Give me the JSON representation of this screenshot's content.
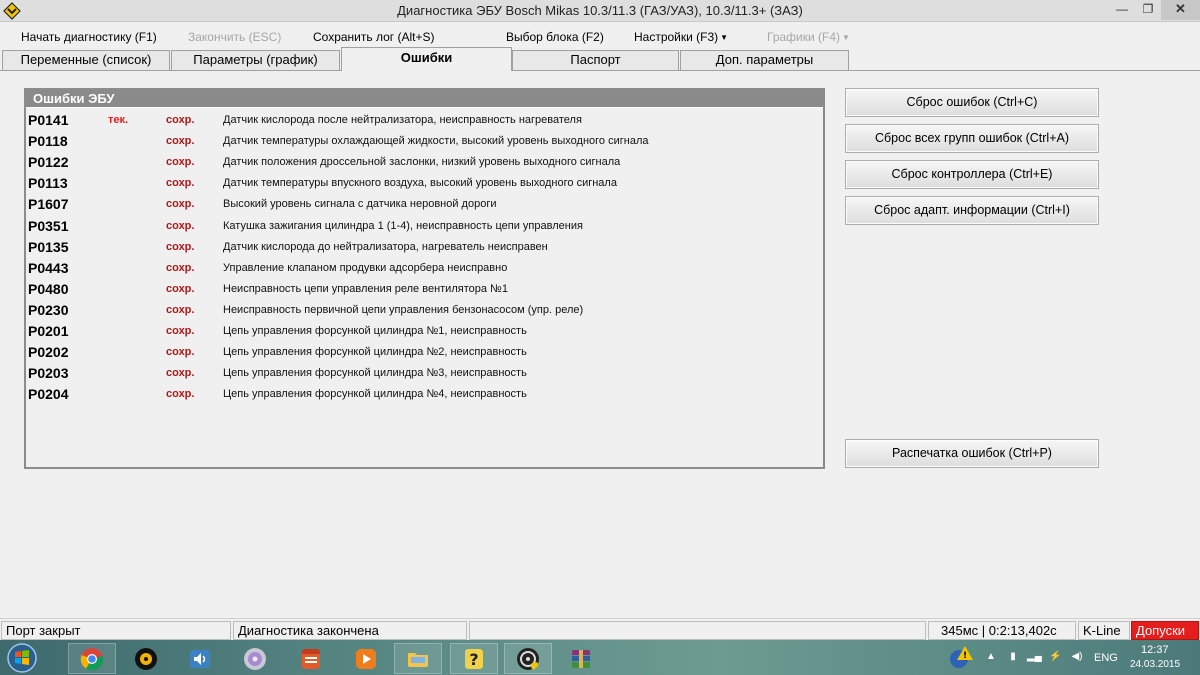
{
  "window": {
    "title": "Диагностика ЭБУ Bosch Mikas 10.3/11.3 (ГАЗ/УАЗ), 10.3/11.3+ (ЗАЗ)",
    "minimize_glyph": "—",
    "maximize_glyph": "❐",
    "close_glyph": "✕"
  },
  "menu": {
    "start": "Начать диагностику (F1)",
    "stop": "Закончить (ESC)",
    "save_log": "Сохранить лог (Alt+S)",
    "select_unit": "Выбор блока (F2)",
    "settings": "Настройки (F3)",
    "graphs": "Графики (F4)"
  },
  "tabs": [
    {
      "label": "Переменные (список)"
    },
    {
      "label": "Параметры (график)"
    },
    {
      "label": "Ошибки"
    },
    {
      "label": "Паспорт"
    },
    {
      "label": "Доп. параметры"
    }
  ],
  "errors_panel": {
    "title": "Ошибки ЭБУ",
    "rows": [
      {
        "code": "P0141",
        "current": "тек.",
        "saved": "сохр.",
        "desc": "Датчик кислорода после нейтрализатора, неисправность нагревателя"
      },
      {
        "code": "P0118",
        "current": "",
        "saved": "сохр.",
        "desc": "Датчик температуры охлаждающей жидкости, высокий уровень выходного сигнала"
      },
      {
        "code": "P0122",
        "current": "",
        "saved": "сохр.",
        "desc": "Датчик положения дроссельной заслонки, низкий уровень выходного сигнала"
      },
      {
        "code": "P0113",
        "current": "",
        "saved": "сохр.",
        "desc": "Датчик температуры впускного воздуха, высокий уровень выходного сигнала"
      },
      {
        "code": "P1607",
        "current": "",
        "saved": "сохр.",
        "desc": "Высокий уровень сигнала с датчика неровной дороги"
      },
      {
        "code": "P0351",
        "current": "",
        "saved": "сохр.",
        "desc": "Катушка зажигания цилиндра 1 (1-4), неисправность цепи управления"
      },
      {
        "code": "P0135",
        "current": "",
        "saved": "сохр.",
        "desc": "Датчик кислорода до нейтрализатора, нагреватель неисправен"
      },
      {
        "code": "P0443",
        "current": "",
        "saved": "сохр.",
        "desc": "Управление клапаном продувки адсорбера неисправно"
      },
      {
        "code": "P0480",
        "current": "",
        "saved": "сохр.",
        "desc": "Неисправность цепи управления реле вентилятора №1"
      },
      {
        "code": "P0230",
        "current": "",
        "saved": "сохр.",
        "desc": "Неисправность первичной цепи управления бензонасосом (упр. реле)"
      },
      {
        "code": "P0201",
        "current": "",
        "saved": "сохр.",
        "desc": "Цепь управления форсункой цилиндра №1, неисправность"
      },
      {
        "code": "P0202",
        "current": "",
        "saved": "сохр.",
        "desc": "Цепь управления форсункой цилиндра №2, неисправность"
      },
      {
        "code": "P0203",
        "current": "",
        "saved": "сохр.",
        "desc": "Цепь управления форсункой цилиндра №3, неисправность"
      },
      {
        "code": "P0204",
        "current": "",
        "saved": "сохр.",
        "desc": "Цепь управления форсункой цилиндра №4, неисправность"
      }
    ]
  },
  "buttons": {
    "reset_errors": "Сброс ошибок (Ctrl+C)",
    "reset_all_groups": "Сброс всех групп ошибок (Ctrl+A)",
    "reset_controller": "Сброс контроллера (Ctrl+E)",
    "reset_adaptation": "Сброс адапт. информации (Ctrl+I)",
    "print_errors": "Распечатка ошибок (Ctrl+P)"
  },
  "statusbar": {
    "port": "Порт закрыт",
    "diag": "Диагностика закончена",
    "timing": "345мс | 0:2:13,402с",
    "protocol": "K-Line",
    "access": "Допуски"
  },
  "taskbar": {
    "lang": "ENG",
    "time": "12:37",
    "date": "24.03.2015"
  },
  "colors": {
    "current_error": "#e02020",
    "saved_error": "#b01818",
    "access_badge": "#e41d1d"
  }
}
